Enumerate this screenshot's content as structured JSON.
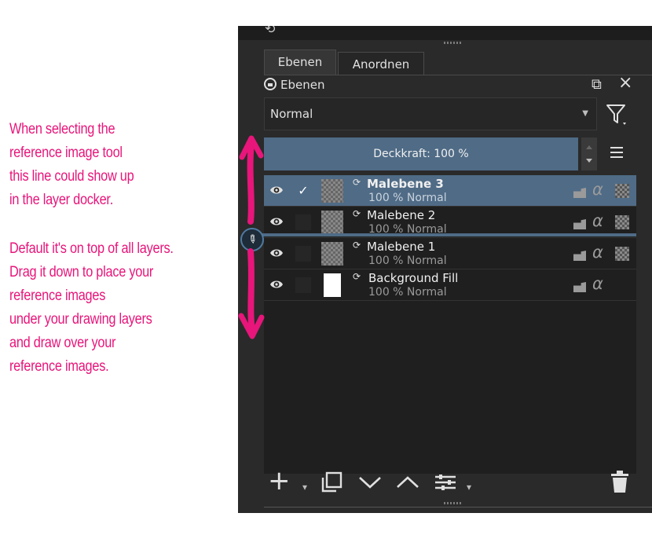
{
  "annotation": {
    "block1": [
      "When selecting the",
      "reference image tool",
      "this line could show up",
      "in the layer docker."
    ],
    "block2": [
      "Default it's on top of all layers.",
      "Drag it down to place your",
      "reference images",
      "under your drawing layers",
      "and draw over your",
      "reference images."
    ]
  },
  "docker": {
    "tabs": [
      "Ebenen",
      "Anordnen"
    ],
    "title": "Ebenen",
    "blend_mode": "Normal",
    "opacity_label": "Deckkraft:  100 %",
    "layers": [
      {
        "name": "Malebene 3",
        "mode": "100 % Normal",
        "selected": true,
        "checked": "✓"
      },
      {
        "name": "Malebene 2",
        "mode": "100 % Normal",
        "selected": false,
        "checked": ""
      },
      {
        "name": "Malebene 1",
        "mode": "100 % Normal",
        "selected": false,
        "checked": ""
      },
      {
        "name": "Background Fill",
        "mode": "100 % Normal",
        "selected": false,
        "checked": ""
      }
    ]
  },
  "icons": {
    "accent": "#e8157a",
    "selection": "#4f6b86"
  }
}
